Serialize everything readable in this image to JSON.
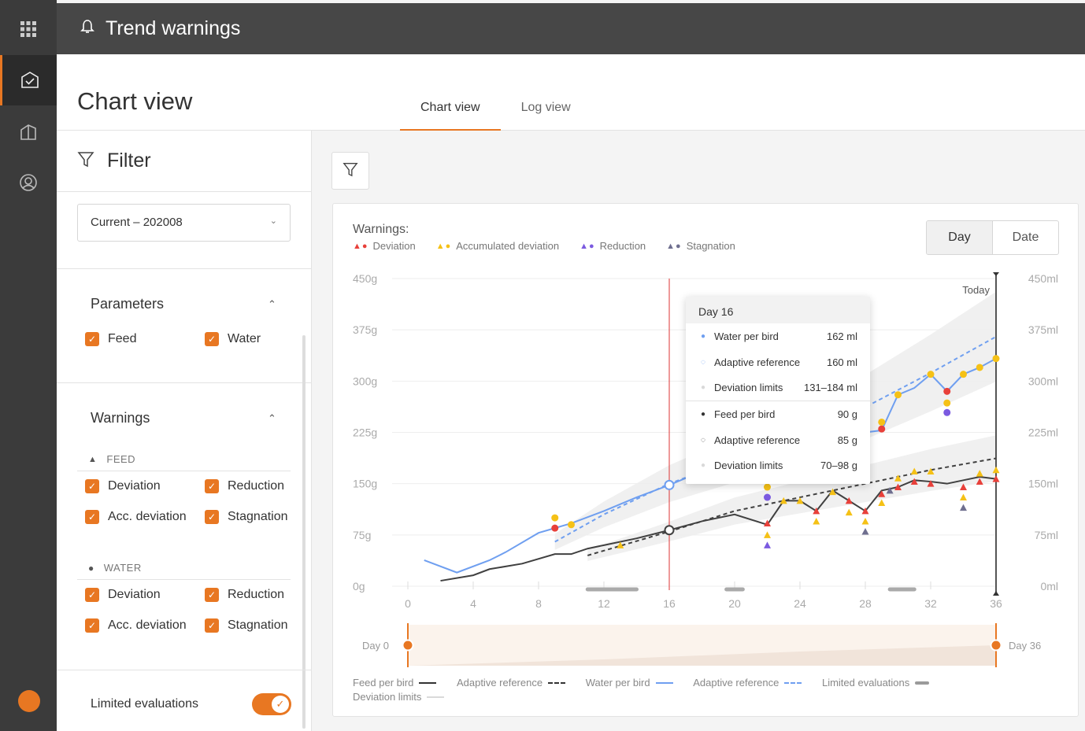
{
  "app": {
    "title": "Trend warnings"
  },
  "header": {
    "page_title": "Chart view",
    "tabs": [
      {
        "label": "Chart view",
        "active": true
      },
      {
        "label": "Log view",
        "active": false
      }
    ]
  },
  "filter": {
    "title": "Filter",
    "flock_select": "Current – 202008",
    "parameters": {
      "title": "Parameters",
      "items": [
        {
          "label": "Feed",
          "checked": true
        },
        {
          "label": "Water",
          "checked": true
        }
      ]
    },
    "warnings": {
      "title": "Warnings",
      "feed": {
        "label": "FEED",
        "items": [
          {
            "label": "Deviation"
          },
          {
            "label": "Reduction"
          },
          {
            "label": "Acc. deviation"
          },
          {
            "label": "Stagnation"
          }
        ]
      },
      "water": {
        "label": "WATER",
        "items": [
          {
            "label": "Deviation"
          },
          {
            "label": "Reduction"
          },
          {
            "label": "Acc. deviation"
          },
          {
            "label": "Stagnation"
          }
        ]
      }
    },
    "limited_evaluations": {
      "label": "Limited evaluations",
      "on": true
    }
  },
  "card": {
    "warnings_label": "Warnings:",
    "legend": [
      {
        "label": "Deviation",
        "colors": [
          "#e8403a",
          "#e8403a"
        ]
      },
      {
        "label": "Accumulated deviation",
        "colors": [
          "#f5c116",
          "#f5c116"
        ]
      },
      {
        "label": "Reduction",
        "colors": [
          "#7b5ae0",
          "#7b5ae0"
        ]
      },
      {
        "label": "Stagnation",
        "colors": [
          "#6f6f8f",
          "#6f6f8f"
        ]
      }
    ],
    "view_toggle": {
      "day": "Day",
      "date": "Date",
      "selected": "Day"
    },
    "today_label": "Today",
    "range_start": "Day 0",
    "range_end": "Day 36",
    "bottom_legend": [
      {
        "label": "Feed per bird",
        "color": "#333333",
        "style": "solid"
      },
      {
        "label": "Adaptive reference",
        "color": "#333333",
        "style": "dashed"
      },
      {
        "label": "Water per bird",
        "color": "#6f9ff0",
        "style": "solid"
      },
      {
        "label": "Adaptive reference",
        "color": "#6f9ff0",
        "style": "dashed"
      },
      {
        "label": "Limited evaluations",
        "color": "#9a9a9a",
        "style": "thick"
      },
      {
        "label": "Deviation limits",
        "color": "#d9d9d9",
        "style": "solid"
      }
    ]
  },
  "tooltip": {
    "title": "Day 16",
    "rows": [
      {
        "label": "Water per bird",
        "value": "162 ml"
      },
      {
        "label": "Adaptive reference",
        "value": "160 ml"
      },
      {
        "label": "Deviation limits",
        "value": "131–184 ml"
      },
      {
        "label": "Feed per bird",
        "value": "90 g"
      },
      {
        "label": "Adaptive reference",
        "value": "85 g"
      },
      {
        "label": "Deviation limits",
        "value": "70–98 g"
      }
    ]
  },
  "chart_data": {
    "type": "line",
    "x_ticks": [
      0,
      4,
      8,
      12,
      16,
      20,
      24,
      28,
      32,
      36
    ],
    "left_ticks": [
      "0g",
      "75g",
      "150g",
      "225g",
      "300g",
      "375g",
      "450g"
    ],
    "right_ticks": [
      "0ml",
      "75ml",
      "150ml",
      "225ml",
      "300ml",
      "375ml",
      "450ml"
    ],
    "xlim": [
      0,
      36
    ],
    "ylim": [
      0,
      450
    ],
    "series": [
      {
        "name": "Water per bird",
        "x": [
          1,
          3,
          5,
          6,
          8,
          9,
          10,
          12,
          14,
          16,
          17,
          20,
          22,
          23,
          24,
          25,
          26,
          27,
          28,
          29,
          30,
          31,
          32,
          33,
          34,
          35,
          36
        ],
        "y": [
          38,
          20,
          38,
          50,
          78,
          85,
          92,
          110,
          130,
          148,
          158,
          168,
          178,
          188,
          198,
          205,
          210,
          218,
          225,
          228,
          280,
          290,
          310,
          285,
          310,
          320,
          333
        ]
      },
      {
        "name": "Adaptive reference",
        "x": [
          9,
          12,
          16,
          20,
          24,
          28,
          32,
          36
        ],
        "y": [
          65,
          105,
          150,
          185,
          222,
          262,
          312,
          365
        ]
      },
      {
        "name": "Feed per bird",
        "x": [
          2,
          4,
          5,
          7,
          9,
          10,
          11,
          12,
          14,
          16,
          18,
          20,
          22,
          23,
          24,
          25,
          26,
          27,
          28,
          29,
          30,
          31,
          32,
          33,
          34,
          35,
          36
        ],
        "y": [
          8,
          16,
          25,
          33,
          47,
          47,
          55,
          60,
          70,
          82,
          95,
          105,
          90,
          125,
          125,
          110,
          140,
          125,
          110,
          140,
          145,
          155,
          153,
          150,
          155,
          160,
          157
        ]
      },
      {
        "name": "Adaptive reference",
        "x": [
          11,
          12,
          16,
          20,
          24,
          28,
          32,
          36
        ],
        "y": [
          45,
          52,
          80,
          110,
          130,
          150,
          170,
          187
        ]
      }
    ],
    "warnings": [
      {
        "x": 9,
        "y": 100,
        "color": "#f5c116",
        "shape": "dot"
      },
      {
        "x": 9,
        "y": 85,
        "color": "#e8403a",
        "shape": "dot"
      },
      {
        "x": 10,
        "y": 90,
        "color": "#f5c116",
        "shape": "dot"
      },
      {
        "x": 13,
        "y": 60,
        "color": "#f5c116",
        "shape": "tri"
      },
      {
        "x": 22,
        "y": 145,
        "color": "#f5c116",
        "shape": "dot"
      },
      {
        "x": 22,
        "y": 130,
        "color": "#7b5ae0",
        "shape": "dot"
      },
      {
        "x": 22,
        "y": 92,
        "color": "#e8403a",
        "shape": "tri"
      },
      {
        "x": 22,
        "y": 75,
        "color": "#f5c116",
        "shape": "tri"
      },
      {
        "x": 22,
        "y": 60,
        "color": "#7b5ae0",
        "shape": "tri"
      },
      {
        "x": 23,
        "y": 125,
        "color": "#f5c116",
        "shape": "tri"
      },
      {
        "x": 24,
        "y": 125,
        "color": "#f5c116",
        "shape": "tri"
      },
      {
        "x": 25,
        "y": 110,
        "color": "#e8403a",
        "shape": "tri"
      },
      {
        "x": 25,
        "y": 95,
        "color": "#f5c116",
        "shape": "tri"
      },
      {
        "x": 26,
        "y": 138,
        "color": "#f5c116",
        "shape": "tri"
      },
      {
        "x": 27,
        "y": 125,
        "color": "#e8403a",
        "shape": "tri"
      },
      {
        "x": 27,
        "y": 108,
        "color": "#f5c116",
        "shape": "tri"
      },
      {
        "x": 28,
        "y": 110,
        "color": "#e8403a",
        "shape": "tri"
      },
      {
        "x": 28,
        "y": 95,
        "color": "#f5c116",
        "shape": "tri"
      },
      {
        "x": 28,
        "y": 80,
        "color": "#6f6f8f",
        "shape": "tri"
      },
      {
        "x": 29,
        "y": 230,
        "color": "#e8403a",
        "shape": "dot"
      },
      {
        "x": 29,
        "y": 240,
        "color": "#f5c116",
        "shape": "dot"
      },
      {
        "x": 29,
        "y": 135,
        "color": "#e8403a",
        "shape": "tri"
      },
      {
        "x": 29,
        "y": 122,
        "color": "#f5c116",
        "shape": "tri"
      },
      {
        "x": 29.5,
        "y": 140,
        "color": "#6f6f8f",
        "shape": "tri"
      },
      {
        "x": 30,
        "y": 280,
        "color": "#f5c116",
        "shape": "dot"
      },
      {
        "x": 30,
        "y": 145,
        "color": "#e8403a",
        "shape": "tri"
      },
      {
        "x": 30,
        "y": 158,
        "color": "#f5c116",
        "shape": "tri"
      },
      {
        "x": 31,
        "y": 168,
        "color": "#f5c116",
        "shape": "tri"
      },
      {
        "x": 31,
        "y": 153,
        "color": "#e8403a",
        "shape": "tri"
      },
      {
        "x": 32,
        "y": 310,
        "color": "#f5c116",
        "shape": "dot"
      },
      {
        "x": 32,
        "y": 168,
        "color": "#f5c116",
        "shape": "tri"
      },
      {
        "x": 32,
        "y": 150,
        "color": "#e8403a",
        "shape": "tri"
      },
      {
        "x": 33,
        "y": 285,
        "color": "#e8403a",
        "shape": "dot"
      },
      {
        "x": 33,
        "y": 268,
        "color": "#f5c116",
        "shape": "dot"
      },
      {
        "x": 33,
        "y": 254,
        "color": "#7b5ae0",
        "shape": "dot"
      },
      {
        "x": 34,
        "y": 310,
        "color": "#f5c116",
        "shape": "dot"
      },
      {
        "x": 34,
        "y": 145,
        "color": "#e8403a",
        "shape": "tri"
      },
      {
        "x": 34,
        "y": 130,
        "color": "#f5c116",
        "shape": "tri"
      },
      {
        "x": 34,
        "y": 115,
        "color": "#6f6f8f",
        "shape": "tri"
      },
      {
        "x": 35,
        "y": 320,
        "color": "#f5c116",
        "shape": "dot"
      },
      {
        "x": 35,
        "y": 165,
        "color": "#f5c116",
        "shape": "tri"
      },
      {
        "x": 35,
        "y": 153,
        "color": "#e8403a",
        "shape": "tri"
      },
      {
        "x": 36,
        "y": 333,
        "color": "#f5c116",
        "shape": "dot"
      },
      {
        "x": 36,
        "y": 170,
        "color": "#f5c116",
        "shape": "tri"
      },
      {
        "x": 36,
        "y": 157,
        "color": "#e8403a",
        "shape": "tri"
      }
    ],
    "limited_evaluations": [
      [
        11,
        14
      ],
      [
        19.5,
        20.5
      ],
      [
        29.5,
        31
      ]
    ],
    "cursor_day": 16,
    "today_day": 36
  }
}
